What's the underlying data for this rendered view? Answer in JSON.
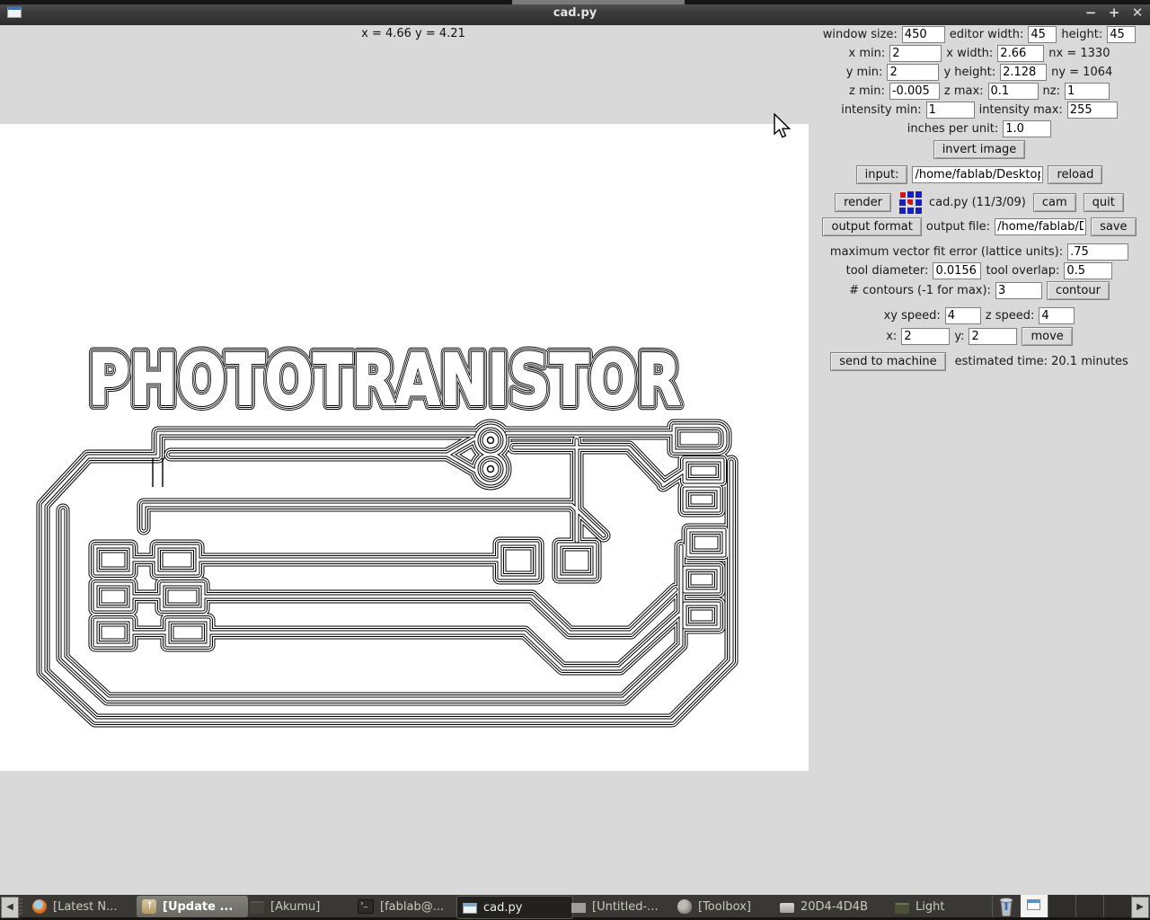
{
  "titlebar": {
    "title": "cad.py",
    "minimize": "−",
    "maximize": "+",
    "close": "✕"
  },
  "readout": "x = 4.66  y = 4.21",
  "canvas": {
    "board_title": "PHOTOTRANISTOR"
  },
  "panel": {
    "window_size": {
      "label": "window size:",
      "value": "450"
    },
    "editor_width": {
      "label": "editor width:",
      "value": "45"
    },
    "editor_height": {
      "label": "height:",
      "value": "45"
    },
    "x_min": {
      "label": "x min:",
      "value": "2"
    },
    "x_width": {
      "label": "x width:",
      "value": "2.66"
    },
    "nx": "nx = 1330",
    "y_min": {
      "label": "y min:",
      "value": "2"
    },
    "y_height": {
      "label": "y height:",
      "value": "2.128"
    },
    "ny": "ny = 1064",
    "z_min": {
      "label": "z min:",
      "value": "-0.005"
    },
    "z_max": {
      "label": "z max:",
      "value": "0.1"
    },
    "nz": {
      "label": "nz:",
      "value": "1"
    },
    "intensity_min": {
      "label": "intensity min:",
      "value": "1"
    },
    "intensity_max": {
      "label": "intensity max:",
      "value": "255"
    },
    "inches_per_unit": {
      "label": "inches per unit:",
      "value": "1.0"
    },
    "invert_image": "invert image",
    "input_button": "input:",
    "input_path": "/home/fablab/Desktop/.",
    "reload": "reload",
    "render": "render",
    "version": "cad.py (11/3/09)",
    "cam": "cam",
    "quit": "quit",
    "output_format": "output format",
    "output_file_label": "output file:",
    "output_path": "/home/fablab/De",
    "save": "save",
    "fit_error": {
      "label": "maximum vector fit error (lattice units):",
      "value": ".75"
    },
    "tool_diameter": {
      "label": "tool diameter:",
      "value": "0.0156"
    },
    "tool_overlap": {
      "label": "tool overlap:",
      "value": "0.5"
    },
    "contours": {
      "label": "# contours (-1 for max):",
      "value": "3"
    },
    "contour": "contour",
    "xy_speed": {
      "label": "xy speed:",
      "value": "4"
    },
    "z_speed": {
      "label": "z speed:",
      "value": "4"
    },
    "x": {
      "label": "x:",
      "value": "2"
    },
    "y": {
      "label": "y:",
      "value": "2"
    },
    "move": "move",
    "send": "send to machine",
    "estimated_time": "estimated time: 20.1 minutes"
  },
  "taskbar": {
    "back": "◀",
    "forward": "▶",
    "items": [
      {
        "label": "[Latest N...",
        "icon": "firefox-icon"
      },
      {
        "label": "[Update ...",
        "icon": "update-manager-icon"
      },
      {
        "label": "[Akumu]",
        "icon": "archive-icon"
      },
      {
        "label": "[fablab@...",
        "icon": "terminal-icon"
      },
      {
        "label": "cad.py",
        "icon": "window-icon"
      },
      {
        "label": "[Untitled-...",
        "icon": "document-icon"
      },
      {
        "label": "[Toolbox]",
        "icon": "gimp-icon"
      },
      {
        "label": "20D4-4D4B",
        "icon": "drive-icon"
      },
      {
        "label": "Light",
        "icon": "box-icon"
      }
    ]
  }
}
